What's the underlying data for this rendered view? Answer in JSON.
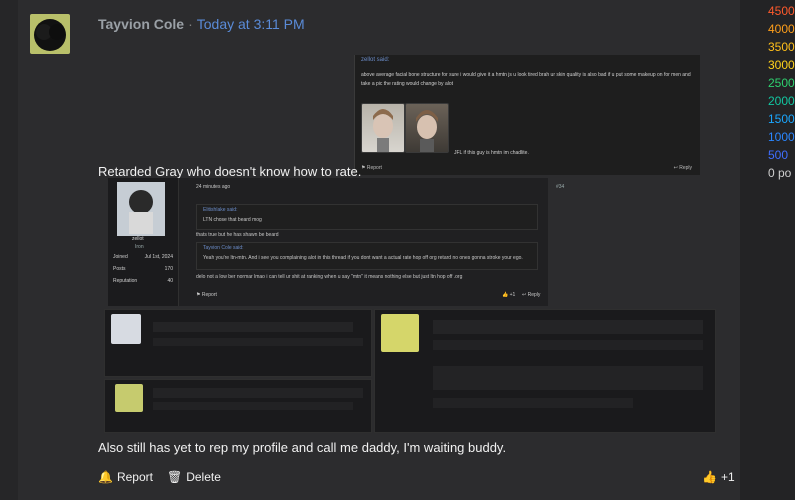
{
  "post": {
    "author": "Tayvion Cole",
    "separator": "·",
    "timestamp": "Today at 3:11 PM",
    "main_text": "Retarded Gray who doesn't know how to rate.",
    "bottom_text": "Also still has yet to rep my profile and call me daddy, I'm waiting buddy.",
    "actions": {
      "report_label": "Report",
      "delete_label": "Delete",
      "like_count": "+1"
    }
  },
  "quote_card": {
    "name": "zellot said:",
    "text": "above average facial bone structure for sure i would give it a hmtn js u look tired brah ur skin quality is also bad if u put some makeup on for men and take a pic the rating would change by alot",
    "caption": "JFL if this guy is hmtn im chadlite.",
    "report": "Report",
    "reply": "Reply"
  },
  "sub_embed": {
    "time": "24 minutes ago",
    "post_no": "#34",
    "username": "zellot",
    "role": "Iron",
    "joined_label": "Joined",
    "joined_value": "Jul 1st, 2024",
    "posts_label": "Posts",
    "posts_value": "170",
    "rep_label": "Reputation",
    "rep_value": "40",
    "quote1_name": "Elitishlake said:",
    "quote1_text": "LTN chose that beard mog",
    "line2": "thats true but he has shawn be beard",
    "quote2_name": "Tayvion Cole said:",
    "quote2_text": "Yeah you're ltn-mtn. And i see you complaining alot in this thread if you dont want a actual rate hop off org retard no ones gonna stroke your ego.",
    "line3": "delo not a low ber normar lmao i can tell ur shit at ranking when u say \"mtn\" it means nothing else but just ltn hop off .org",
    "report": "Report",
    "like": "+1",
    "reply": "Reply"
  },
  "right_panel": {
    "levels": [
      {
        "label": "4500",
        "color": "#ff5a2c"
      },
      {
        "label": "4000",
        "color": "#ff9f1a"
      },
      {
        "label": "3500",
        "color": "#ffbf1a"
      },
      {
        "label": "3000",
        "color": "#ffd21a"
      },
      {
        "label": "2500",
        "color": "#2ed06e"
      },
      {
        "label": "2000",
        "color": "#12c6a0"
      },
      {
        "label": "1500",
        "color": "#1aa7ff"
      },
      {
        "label": "1000",
        "color": "#2a86ff"
      },
      {
        "label": "500",
        "color": "#3f6eff"
      },
      {
        "label": "0 po",
        "color": "#cfcfcf"
      }
    ]
  }
}
